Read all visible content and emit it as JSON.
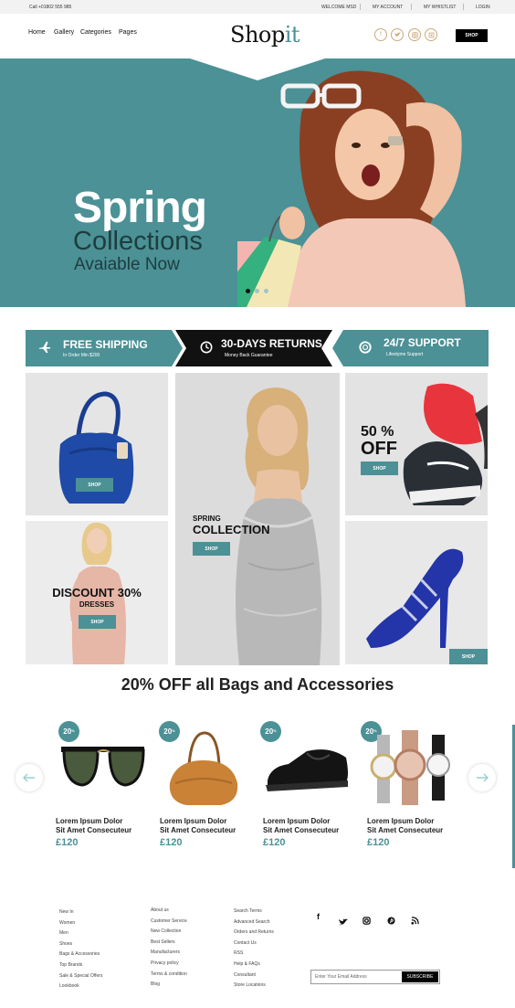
{
  "topbar": {
    "phone": "Call +01802 555 985",
    "links": [
      "WELCOME MSD",
      "MY ACCOUNT",
      "MY WHISTLIST",
      "LOGIN"
    ]
  },
  "header": {
    "nav": [
      "Home",
      "Gallery",
      "Categories",
      "Pages"
    ],
    "logo_main": "Shop",
    "logo_accent": "it",
    "social_icons": [
      "facebook-icon",
      "twitter-icon",
      "instagram-icon",
      "pinterest-icon"
    ],
    "shop_label": "SHOP"
  },
  "hero": {
    "line1": "Spring",
    "line2": "Collections",
    "line3": "Avaiable Now",
    "slides": 3,
    "active_slide": 1
  },
  "features": [
    {
      "title": "FREE SHIPPING",
      "sub": "In Order Min $200",
      "icon": "airplane-icon"
    },
    {
      "title": "30-DAYS RETURNS",
      "sub": "Money Back  Guarantee",
      "icon": "clock-icon"
    },
    {
      "title": "24/7 SUPPORT",
      "sub": "Lifestyme Support",
      "icon": "lifebuoy-icon"
    }
  ],
  "promos": {
    "bag_shop": "SHOP",
    "spring_line1": "SPRING",
    "spring_line2": "COLLECTION",
    "spring_shop": "SHOP",
    "off_line1": "50 %",
    "off_line2": "OFF",
    "off_shop": "SHOP",
    "discount_line1": "DISCOUNT 30%",
    "discount_line2": "DRESSES",
    "discount_shop": "SHOP",
    "heels_shop": "SHOP"
  },
  "section_title": "20% OFF all Bags and Accessories",
  "products": [
    {
      "badge": "20",
      "badge_unit": "%",
      "name1": "Lorem Ipsum Dolor",
      "name2": "Sit Amet Consecuteur",
      "price": "£120",
      "icon": "sunglasses-icon"
    },
    {
      "badge": "20",
      "badge_unit": "%",
      "name1": "Lorem Ipsum Dolor",
      "name2": "Sit Amet Consecuteur",
      "price": "£120",
      "icon": "handbag-icon"
    },
    {
      "badge": "20",
      "badge_unit": "%",
      "name1": "Lorem Ipsum Dolor",
      "name2": "Sit Amet Consecuteur",
      "price": "£120",
      "icon": "shoe-icon"
    },
    {
      "badge": "20",
      "badge_unit": "%",
      "name1": "Lorem Ipsum Dolor",
      "name2": "Sit Amet Consecuteur",
      "price": "£120",
      "icon": "watches-icon"
    }
  ],
  "footer": {
    "col1": [
      "New In",
      "Women",
      "Men",
      "Shoes",
      "Bags & Accessories",
      "Top Brands",
      "Sale & Special Offers",
      "Lookbook"
    ],
    "col2": [
      "About us",
      "Customer Service",
      "New Collection",
      "Best Sellers",
      "Manufacturers",
      "Privacy policy",
      "Terms & condition",
      "Blog"
    ],
    "col3": [
      "Search Terms",
      "Advanced Search",
      "Orders and Returns",
      "Contact Us",
      "RSS",
      "Help & FAQs",
      "Consultant",
      "Store Locations"
    ],
    "social": [
      "f",
      "t",
      "◙",
      "P",
      "≋"
    ],
    "email_placeholder": "Enter Your Email Address",
    "subscribe": "SUBSCRIBE"
  },
  "colors": {
    "teal": "#4b9196",
    "black": "#000000",
    "gold": "#c9a97c"
  }
}
